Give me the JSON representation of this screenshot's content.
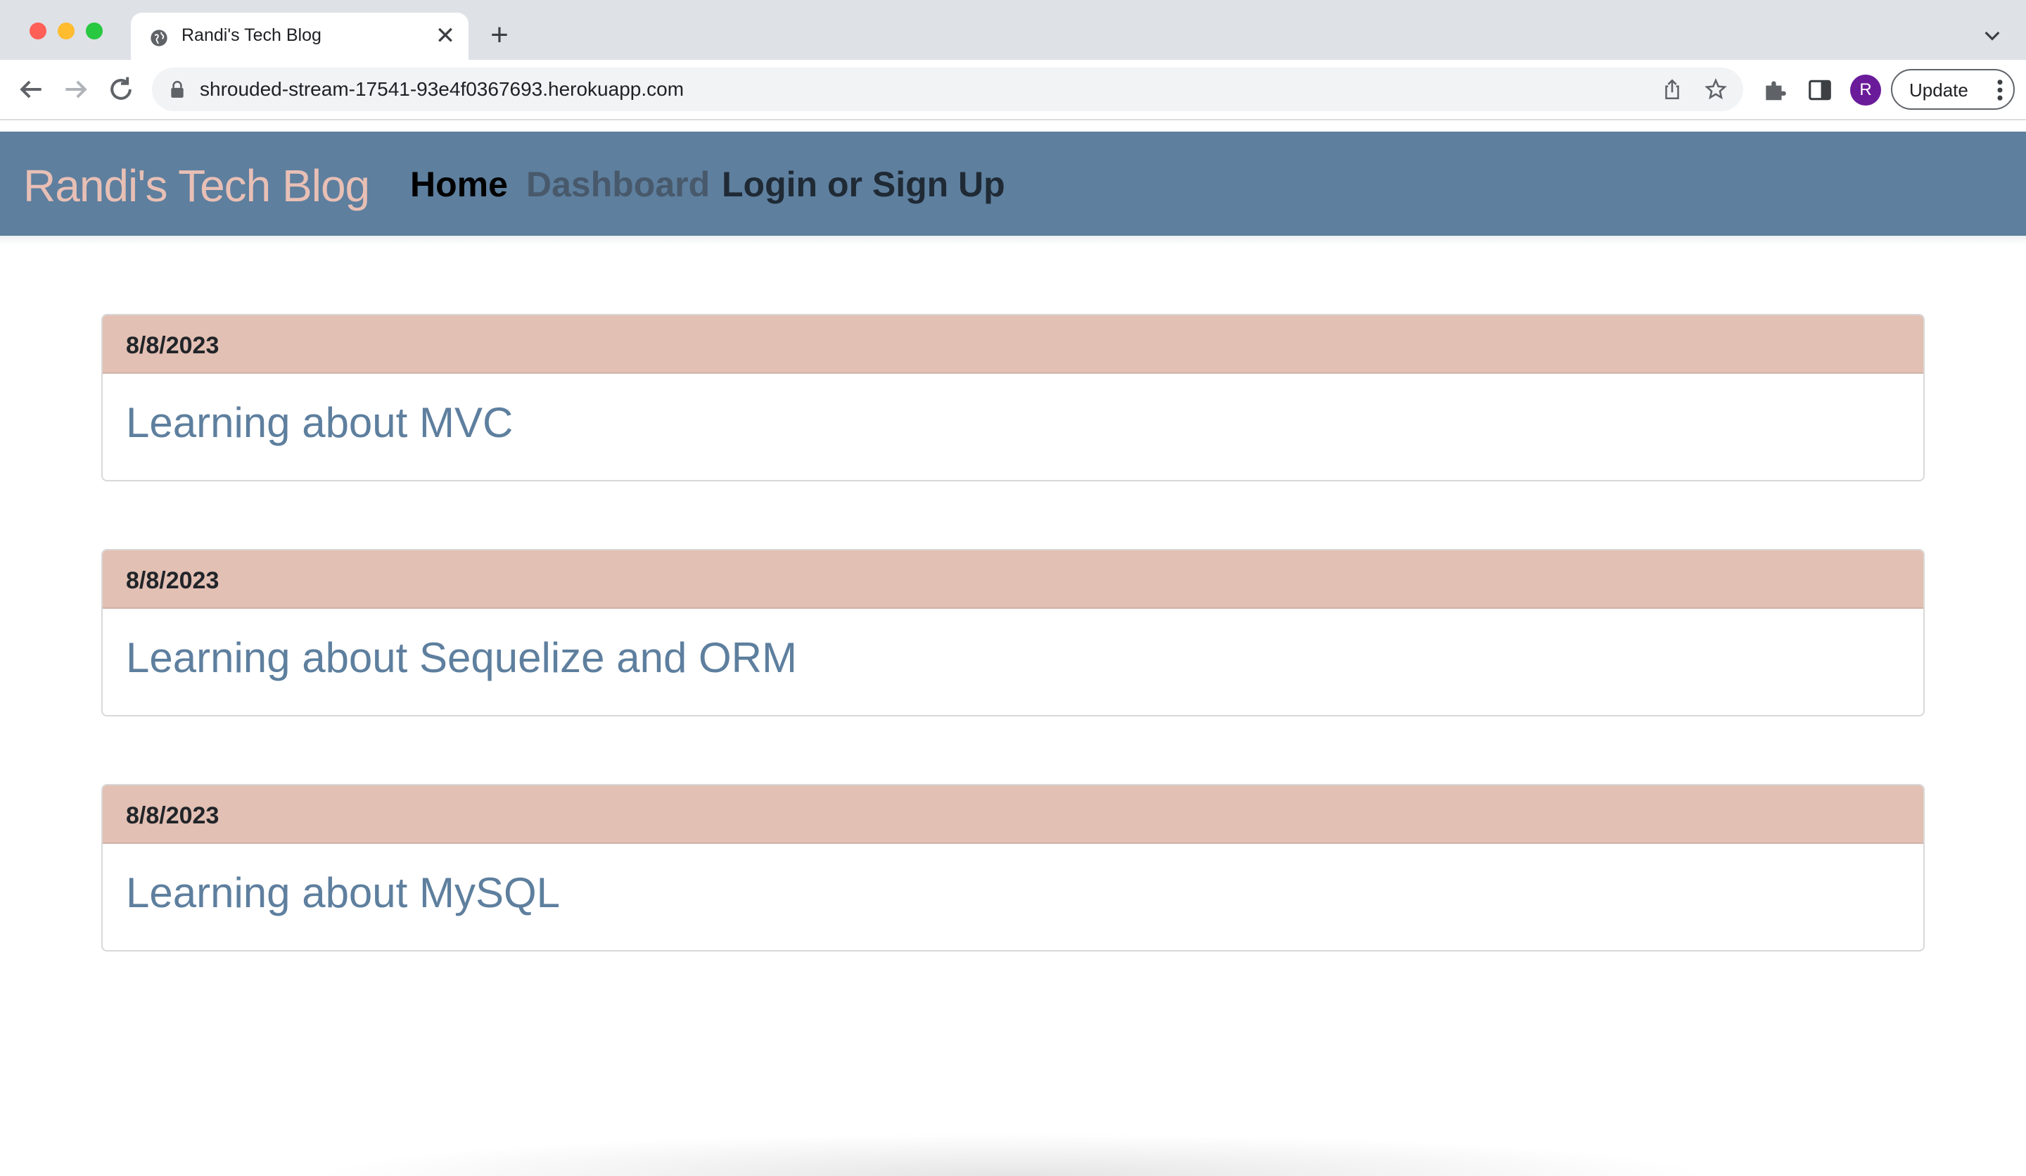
{
  "browser": {
    "tab_title": "Randi's Tech Blog",
    "tab_close": "✕",
    "new_tab": "+",
    "url": "shrouded-stream-17541-93e4f0367693.herokuapp.com",
    "avatar_letter": "R",
    "update_label": "Update"
  },
  "site": {
    "brand": "Randi's Tech Blog",
    "nav": {
      "home": "Home",
      "dashboard": "Dashboard",
      "login": "Login or Sign Up"
    }
  },
  "posts": [
    {
      "date": "8/8/2023",
      "title": "Learning about MVC"
    },
    {
      "date": "8/8/2023",
      "title": "Learning about Sequelize and ORM"
    },
    {
      "date": "8/8/2023",
      "title": "Learning about MySQL"
    }
  ],
  "colors": {
    "header_bg": "#5e7f9e",
    "brand": "#e8bfb5",
    "post_header_bg": "#e3c0b4",
    "post_title": "#5e7f9e"
  }
}
